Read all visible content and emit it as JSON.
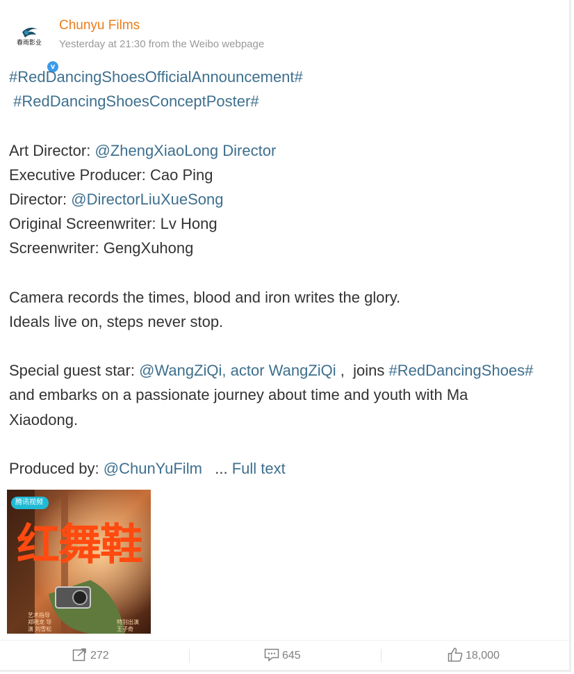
{
  "post": {
    "author": "Chunyu Films",
    "meta": "Yesterday at 21:30 from the Weibo webpage",
    "avatar_text": "春雨影业",
    "lines": {
      "tag1": "#RedDancingShoesOfficialAnnouncement#",
      "tag2": "#RedDancingShoesConceptPoster#",
      "art_director_label": "Art Director: ",
      "art_director_link": "@ZhengXiaoLong Director",
      "exec_producer": "Executive Producer: Cao Ping",
      "director_label": "Director: ",
      "director_link": "@DirectorLiuXueSong",
      "orig_writer": "Original Screenwriter: Lv Hong",
      "writer": "Screenwriter: GengXuhong",
      "slogan1": "Camera records the times, blood and iron writes the glory.",
      "slogan2": "Ideals live on, steps never stop.",
      "guest_label": "Special guest star: ",
      "guest_link": "@WangZiQi, actor WangZiQi",
      "guest_mid": " ,  joins ",
      "guest_tag": "#RedDancingShoes#",
      "guest_cont": "and embarks on a passionate journey about time and youth with Ma",
      "guest_end": "Xiaodong.",
      "produced_label": "Produced by: ",
      "produced_link": "@ChunYuFilm",
      "ellipsis": "   ... ",
      "full_text": "Full text"
    }
  },
  "poster": {
    "badge": "腾讯视频",
    "title": "红舞鞋",
    "credits_left": "艺术指导 郑晓龙 导演 刘雪松",
    "credits_right": "特别出演 王子奇"
  },
  "actions": {
    "repost_count": "272",
    "comment_count": "645",
    "like_count": "18,000"
  },
  "colors": {
    "author": "#eb7d18",
    "link": "#3e6f8e",
    "meta": "#999999",
    "text": "#333333"
  },
  "icons": {
    "repost": "share-arrow-icon",
    "comment": "comment-bubble-icon",
    "like": "thumbs-up-icon",
    "verified": "verified-v-icon"
  }
}
